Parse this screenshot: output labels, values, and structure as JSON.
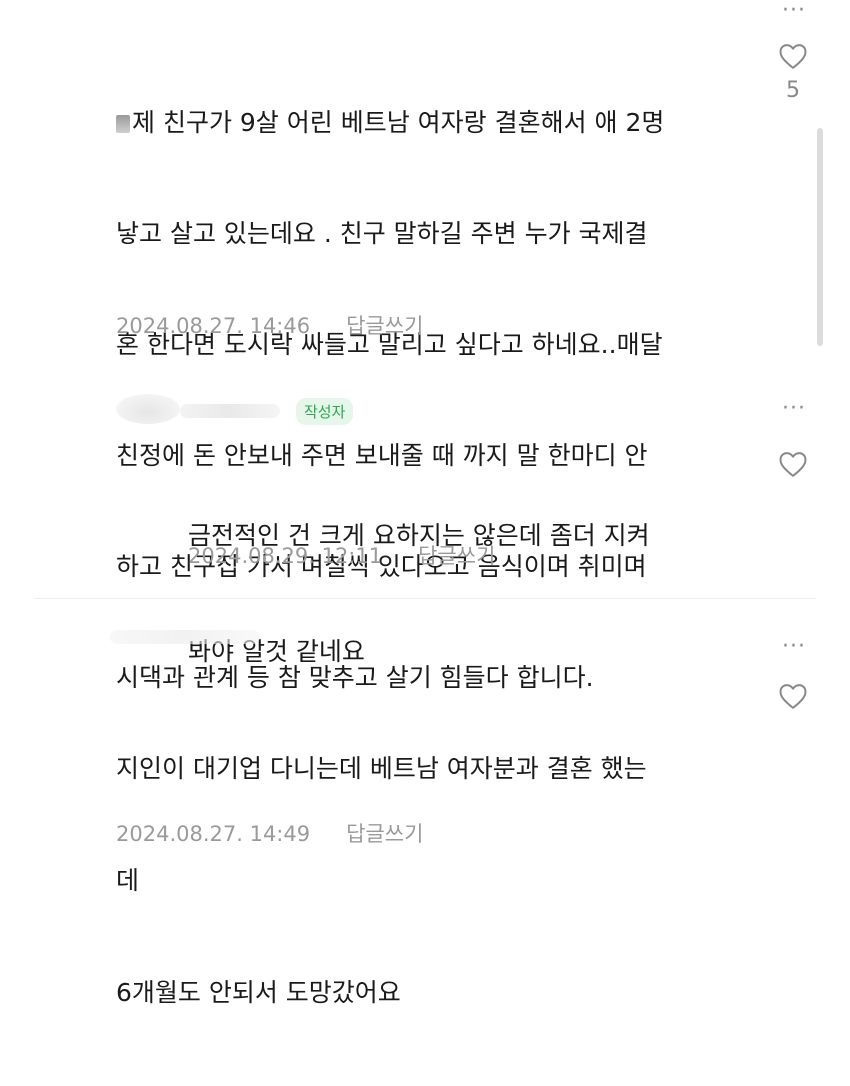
{
  "comments": [
    {
      "text": "제 친구가 9살 어린 베트남 여자랑 결혼해서 애 2명 낳고 살고 있는데요 . 친구 말하길 주변 누가 국제결혼 한다면 도시락 싸들고 말리고 싶다고 하네요..매달 친정에 돈 안보내 주면 보내줄 때 까지 말 한마디 안하고 친구집 가서 며칠씩 있다오고 음식이며 취미며 시댁과 관계 등 참 맞추고 살기 힘들다 합니다.",
      "lines": [
        "제 친구가 9살 어린 베트남 여자랑 결혼해서 애 2명",
        "낳고 살고 있는데요 . 친구 말하길 주변 누가 국제결",
        "혼 한다면 도시락 싸들고 말리고 싶다고 하네요..매달",
        "친정에 돈 안보내 주면 보내줄 때 까지 말 한마디 안",
        "하고 친구집 가서 며칠씩 있다오고 음식이며 취미며",
        "시댁과 관계 등 참 맞추고 살기 힘들다 합니다."
      ],
      "date": "2024.08.27. 14:46",
      "reply_label": "답글쓰기",
      "like_count": "5"
    },
    {
      "badge": "작성자",
      "lines": [
        "금전적인 건 크게 요하지는 않은데 좀더 지켜",
        "봐야 알것 같네요"
      ],
      "date": "2024.08.29. 12:11",
      "reply_label": "답글쓰기"
    },
    {
      "lines": [
        "지인이 대기업 다니는데 베트남 여자분과 결혼 했는",
        "데",
        "6개월도 안되서 도망갔어요"
      ],
      "date": "2024.08.27. 14:49",
      "reply_label": "답글쓰기"
    }
  ],
  "more_glyph": "···",
  "colors": {
    "meta": "#9a9a9a",
    "badge_text": "#2aa94f",
    "badge_bg": "#e6f6ea"
  },
  "icons": {
    "like": "heart-outline-icon",
    "more": "more-dots-icon"
  }
}
